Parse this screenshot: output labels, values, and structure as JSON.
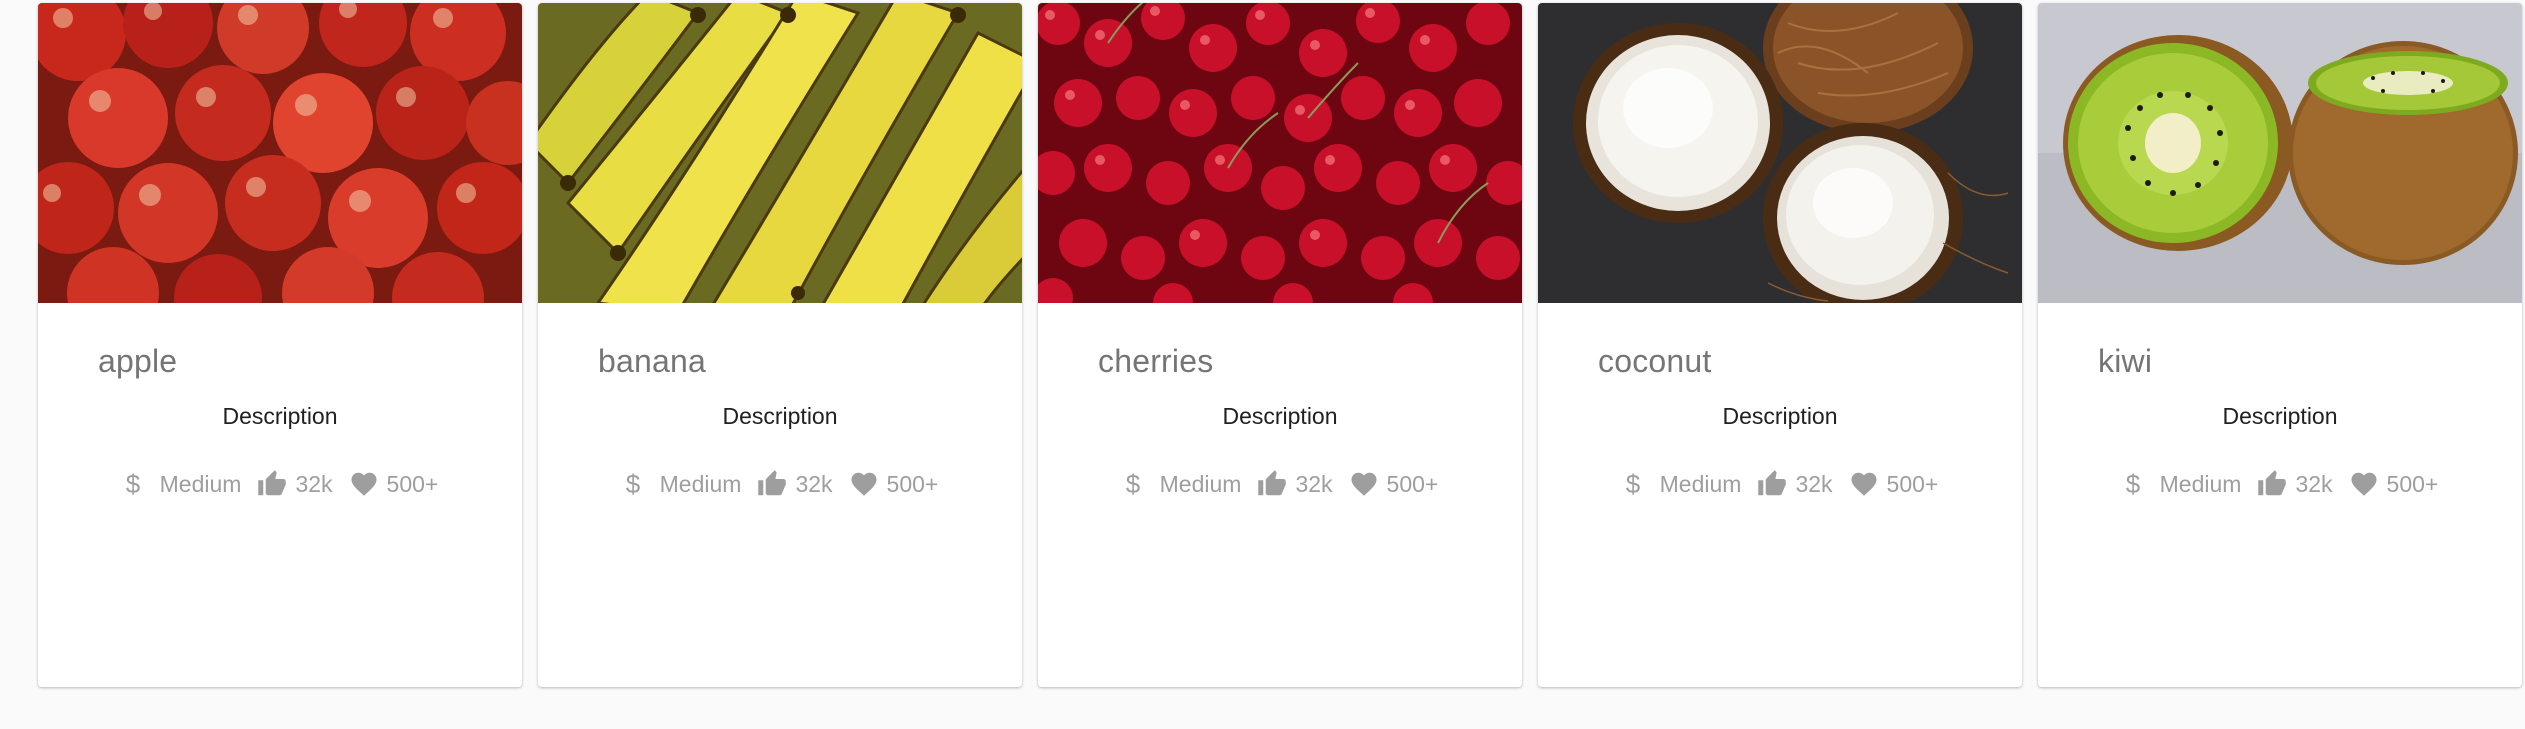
{
  "cards": [
    {
      "title": "apple",
      "description": "Description",
      "price": "Medium",
      "likes": "32k",
      "favorites": "500+",
      "image": "apples"
    },
    {
      "title": "banana",
      "description": "Description",
      "price": "Medium",
      "likes": "32k",
      "favorites": "500+",
      "image": "bananas"
    },
    {
      "title": "cherries",
      "description": "Description",
      "price": "Medium",
      "likes": "32k",
      "favorites": "500+",
      "image": "cherries"
    },
    {
      "title": "coconut",
      "description": "Description",
      "price": "Medium",
      "likes": "32k",
      "favorites": "500+",
      "image": "coconuts"
    },
    {
      "title": "kiwi",
      "description": "Description",
      "price": "Medium",
      "likes": "32k",
      "favorites": "500+",
      "image": "kiwis"
    }
  ],
  "icons": {
    "price": "dollar-icon",
    "likes": "thumb-up-icon",
    "favorites": "heart-icon"
  },
  "colors": {
    "page_bg": "#fafafa",
    "card_bg": "#ffffff",
    "title": "#757575",
    "stat_text": "#9e9e9e",
    "description": "#212121"
  }
}
